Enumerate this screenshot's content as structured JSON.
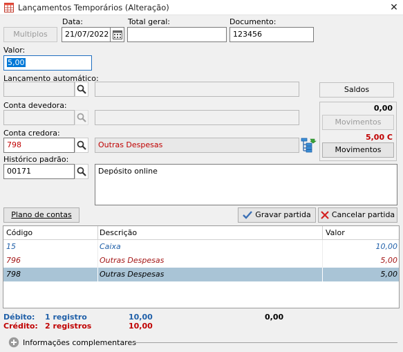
{
  "window": {
    "title": "Lançamentos Temporários (Alteração)",
    "close_glyph": "✕"
  },
  "header": {
    "multiplos_label": "Multiplos",
    "data_label": "Data:",
    "data_value": "21/07/2022",
    "total_geral_label": "Total geral:",
    "total_geral_value": "",
    "documento_label": "Documento:",
    "documento_value": "123456"
  },
  "valor": {
    "label": "Valor:",
    "value": "5,00"
  },
  "lancamento_automatico": {
    "label": "Lançamento automático:",
    "code": "",
    "description": ""
  },
  "saldos": {
    "label": "Saldos",
    "devedora_value": "0,00",
    "movimentos_disabled_label": "Movimentos",
    "credora_value": "5,00 C",
    "movimentos_label": "Movimentos"
  },
  "conta_devedora": {
    "label": "Conta devedora:",
    "code": "",
    "description": ""
  },
  "conta_credora": {
    "label": "Conta credora:",
    "code": "798",
    "description": "Outras Despesas"
  },
  "historico_padrao": {
    "label": "Histórico padrão:",
    "code": "00171",
    "text": "Depósito online"
  },
  "actions": {
    "plano_contas": "Plano de contas",
    "gravar": "Gravar partida",
    "cancelar": "Cancelar partida"
  },
  "table": {
    "columns": [
      "Código",
      "Descrição",
      "Valor"
    ],
    "rows": [
      {
        "codigo": "15",
        "descricao": "Caixa",
        "valor": "10,00",
        "color": "#1f5fa8"
      },
      {
        "codigo": "796",
        "descricao": "Outras Despesas",
        "valor": "5,00",
        "color": "#a31515"
      },
      {
        "codigo": "798",
        "descricao": "Outras Despesas",
        "valor": "5,00",
        "color": "#000000"
      }
    ]
  },
  "totals": {
    "debito_label": "Débito:",
    "debito_registros": "1 registro",
    "debito_valor": "10,00",
    "credito_label": "Crédito:",
    "credito_registros": "2 registros",
    "credito_valor": "10,00",
    "diferenca": "0,00"
  },
  "info": {
    "label": "Informações complementares"
  },
  "colors": {
    "debit": "#1f5fa8",
    "credit": "#c00000",
    "selected_row": "#a9c4d6"
  }
}
